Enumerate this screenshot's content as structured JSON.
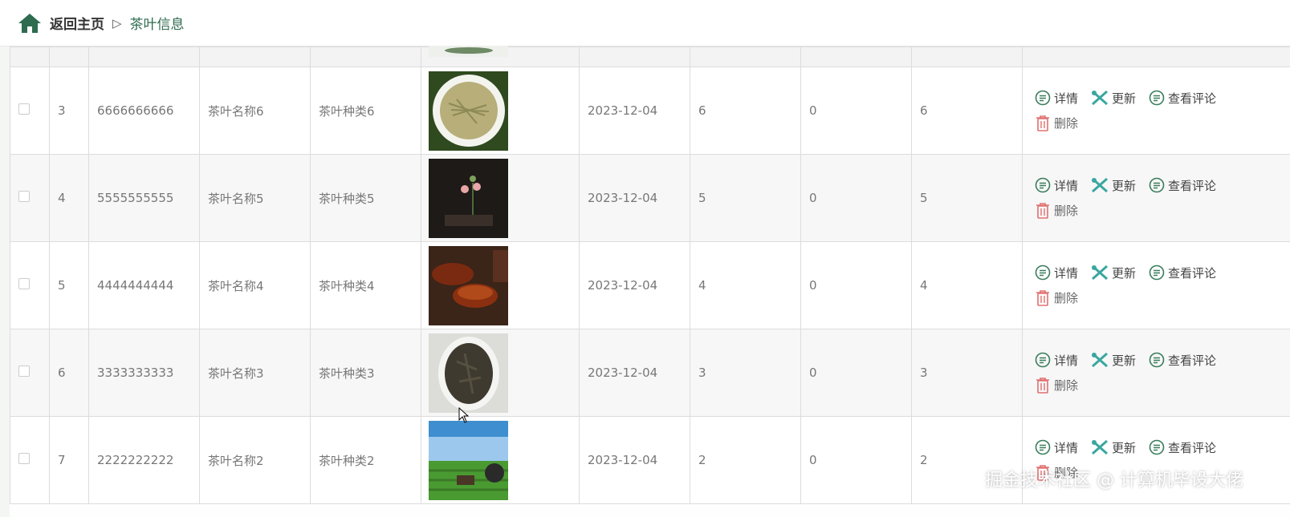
{
  "breadcrumb": {
    "home_label": "返回主页",
    "separator": "▷",
    "current": "茶叶信息"
  },
  "actions": {
    "detail": "详情",
    "update": "更新",
    "comments": "查看评论",
    "delete": "删除"
  },
  "rows": [
    {
      "index": "3",
      "code": "6666666666",
      "name": "茶叶名称6",
      "type": "茶叶种类6",
      "date": "2023-12-04",
      "c1": "6",
      "c2": "0",
      "c3": "6"
    },
    {
      "index": "4",
      "code": "5555555555",
      "name": "茶叶名称5",
      "type": "茶叶种类5",
      "date": "2023-12-04",
      "c1": "5",
      "c2": "0",
      "c3": "5"
    },
    {
      "index": "5",
      "code": "4444444444",
      "name": "茶叶名称4",
      "type": "茶叶种类4",
      "date": "2023-12-04",
      "c1": "4",
      "c2": "0",
      "c3": "4"
    },
    {
      "index": "6",
      "code": "3333333333",
      "name": "茶叶名称3",
      "type": "茶叶种类3",
      "date": "2023-12-04",
      "c1": "3",
      "c2": "0",
      "c3": "3"
    },
    {
      "index": "7",
      "code": "2222222222",
      "name": "茶叶名称2",
      "type": "茶叶种类2",
      "date": "2023-12-04",
      "c1": "2",
      "c2": "0",
      "c3": "2"
    }
  ],
  "watermark": "掘金技术社区 @ 计算机毕设大佬",
  "colors": {
    "brand_green": "#2e6b4f",
    "icon_green": "#3a7d5c",
    "icon_teal": "#3aa7a0",
    "delete_red": "#e07070"
  }
}
